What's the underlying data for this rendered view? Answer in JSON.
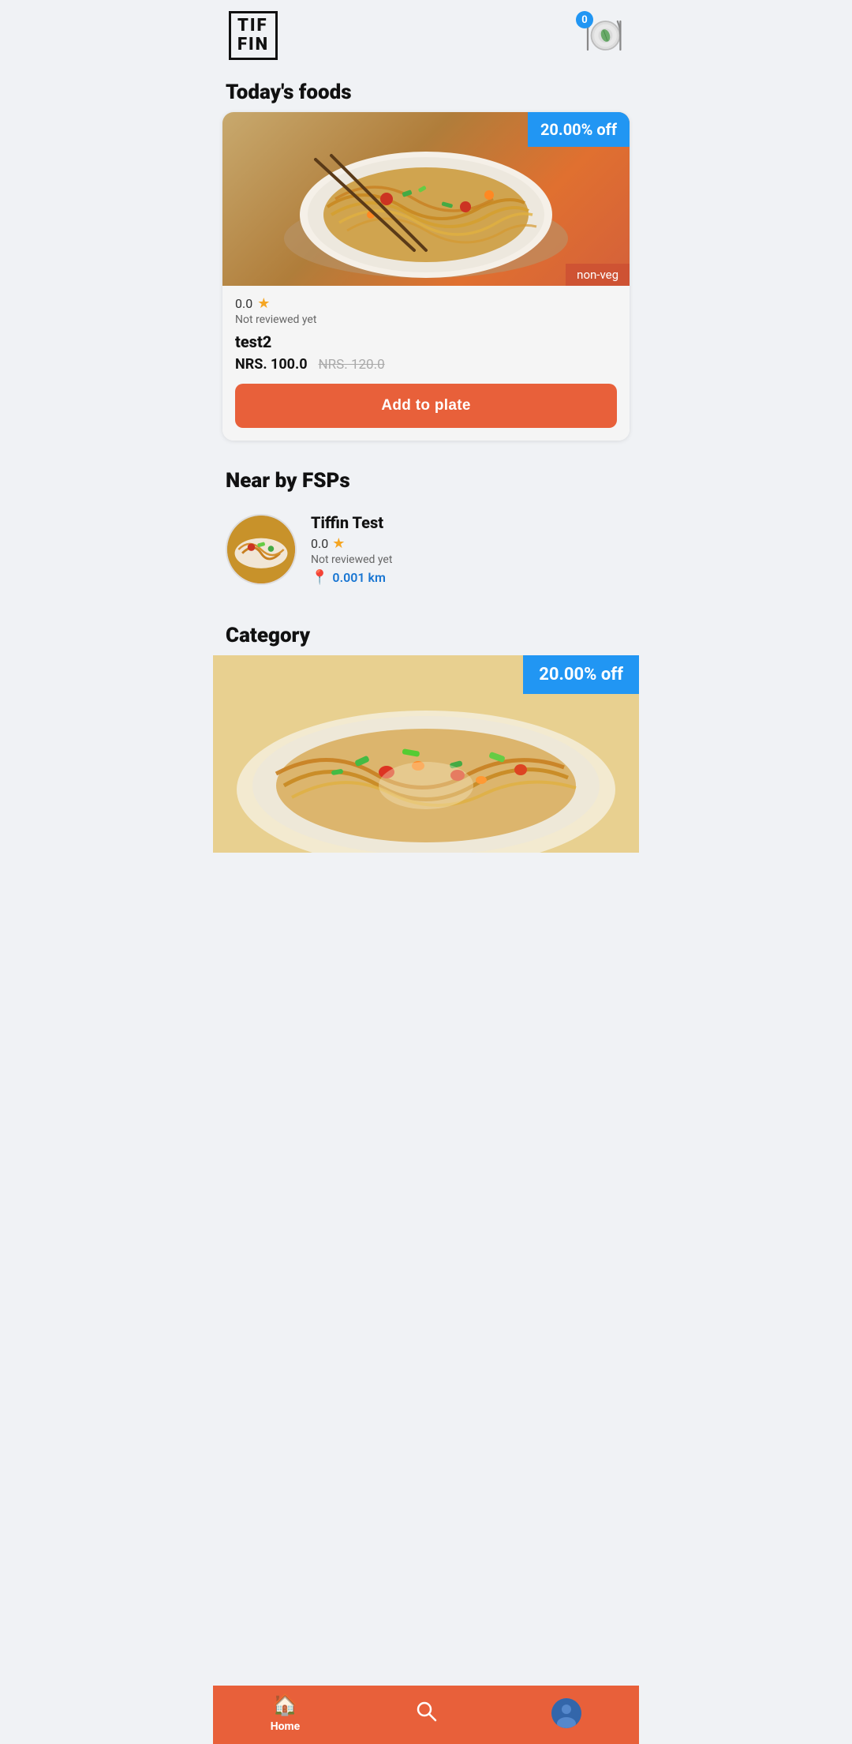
{
  "header": {
    "logo_line1": "TIF",
    "logo_line2": "FIN",
    "cart_count": "0"
  },
  "todays_foods": {
    "section_title": "Today's foods",
    "card": {
      "discount_badge": "20.00% off",
      "food_type": "non-veg",
      "rating": "0.0",
      "not_reviewed": "Not reviewed yet",
      "name": "test2",
      "price_current": "NRS. 100.0",
      "price_original": "NRS. 120.0",
      "add_button": "Add to plate"
    }
  },
  "nearby_fsps": {
    "section_title": "Near by FSPs",
    "items": [
      {
        "name": "Tiffin Test",
        "rating": "0.0",
        "not_reviewed": "Not reviewed yet",
        "distance": "0.001 km"
      }
    ]
  },
  "category": {
    "section_title": "Category",
    "discount_badge": "20.00% off"
  },
  "bottom_nav": {
    "home_label": "Home",
    "home_icon": "🏠",
    "search_icon": "🔍",
    "profile_icon": "👤"
  }
}
